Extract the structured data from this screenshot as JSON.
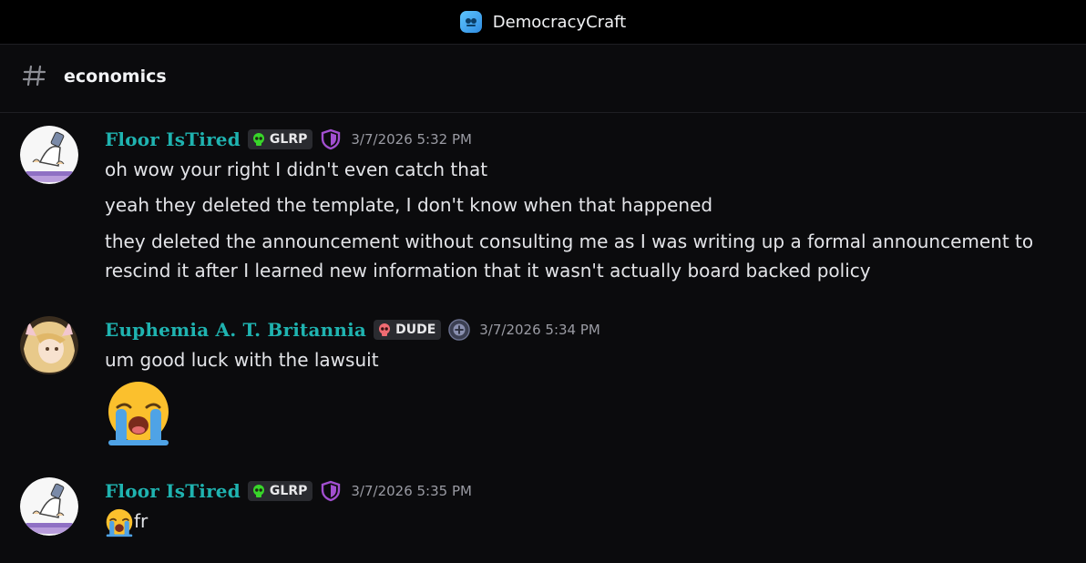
{
  "window": {
    "server_name": "DemocracyCraft"
  },
  "channel": {
    "name": "economics"
  },
  "messages": [
    {
      "author": "Floor IsTired",
      "tag": "GLRP",
      "timestamp": "3/7/2026 5:32 PM",
      "lines": [
        "oh wow your right I didn't even catch that",
        "yeah they deleted the template, I don't know when that happened",
        "they deleted the announcement without consulting me as I was writing up a formal announcement to",
        "rescind it after I learned new information that it wasn't actually board backed policy"
      ]
    },
    {
      "author": "Euphemia A. T. Britannia",
      "tag": "DUDE",
      "timestamp": "3/7/2026 5:34 PM",
      "lines": [
        "um good luck with the lawsuit"
      ]
    },
    {
      "author": "Floor IsTired",
      "tag": "GLRP",
      "timestamp": "3/7/2026 5:35 PM",
      "lines": [
        "fr"
      ]
    }
  ],
  "icons": {
    "server": "server-logo-icon",
    "channel": "hashtag-icon",
    "tag_glrp": "green-skull-icon",
    "tag_dude": "red-skull-icon",
    "role_floor": "purple-shield-icon",
    "role_euphemia": "plus-badge-icon",
    "emoji": "loudly-crying-face-emoji"
  },
  "colors": {
    "username": "#1fb3b0",
    "shield": "#a24fd0",
    "glrp_skull": "#38d62a",
    "dude_skull": "#f06b72"
  }
}
